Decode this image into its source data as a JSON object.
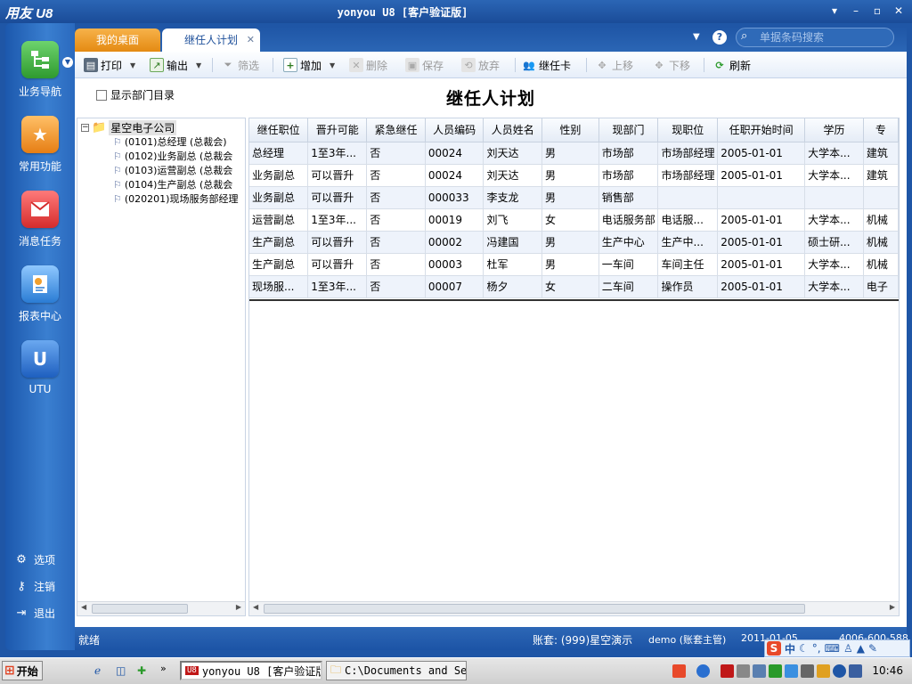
{
  "app": {
    "logo": "用友 U8",
    "title": "yonyou U8 [客户验证版]"
  },
  "window_controls": [
    "▾",
    "–",
    "▫",
    "✕"
  ],
  "nav": {
    "items": [
      {
        "label": "业务导航",
        "color": "#3aa83a"
      },
      {
        "label": "常用功能",
        "color": "#f0922a"
      },
      {
        "label": "消息任务",
        "color": "#e24a4a"
      },
      {
        "label": "报表中心",
        "color": "#3a8fe0"
      },
      {
        "label": "UTU",
        "color": "#2a6fd0"
      }
    ],
    "bottom": [
      {
        "label": "选项"
      },
      {
        "label": "注销"
      },
      {
        "label": "退出"
      }
    ]
  },
  "tabs": [
    {
      "label": "我的桌面"
    },
    {
      "label": "继任人计划"
    }
  ],
  "search": {
    "placeholder": "单据条码搜索"
  },
  "toolbar": {
    "print": "打印",
    "export": "输出",
    "filter": "筛选",
    "add": "增加",
    "delete": "删除",
    "save": "保存",
    "discard": "放弃",
    "successor_card": "继任卡",
    "move_up": "上移",
    "move_down": "下移",
    "refresh": "刷新"
  },
  "options": {
    "show_dept_dir": "显示部门目录"
  },
  "page_title": "继任人计划",
  "tree": {
    "root": "星空电子公司",
    "children": [
      "(0101)总经理 (总裁会)",
      "(0102)业务副总 (总裁会",
      "(0103)运营副总 (总裁会",
      "(0104)生产副总 (总裁会",
      "(020201)现场服务部经理"
    ]
  },
  "grid": {
    "columns": [
      "继任职位",
      "晋升可能",
      "紧急继任",
      "人员编码",
      "人员姓名",
      "性别",
      "现部门",
      "现职位",
      "任职开始时间",
      "学历",
      "专"
    ],
    "rows": [
      [
        "总经理",
        "1至3年...",
        "否",
        "00024",
        "刘天达",
        "男",
        "市场部",
        "市场部经理",
        "2005-01-01",
        "大学本...",
        "建筑"
      ],
      [
        "业务副总",
        "可以晋升",
        "否",
        "00024",
        "刘天达",
        "男",
        "市场部",
        "市场部经理",
        "2005-01-01",
        "大学本...",
        "建筑"
      ],
      [
        "业务副总",
        "可以晋升",
        "否",
        "000033",
        "李支龙",
        "男",
        "销售部",
        "",
        "",
        "",
        ""
      ],
      [
        "运营副总",
        "1至3年...",
        "否",
        "00019",
        "刘飞",
        "女",
        "电话服务部",
        "电话服...",
        "2005-01-01",
        "大学本...",
        "机械"
      ],
      [
        "生产副总",
        "可以晋升",
        "否",
        "00002",
        "冯建国",
        "男",
        "生产中心",
        "生产中...",
        "2005-01-01",
        "硕士研...",
        "机械"
      ],
      [
        "生产副总",
        "可以晋升",
        "否",
        "00003",
        "杜军",
        "男",
        "一车间",
        "车间主任",
        "2005-01-01",
        "大学本...",
        "机械"
      ],
      [
        "现场服...",
        "1至3年...",
        "否",
        "00007",
        "杨夕",
        "女",
        "二车间",
        "操作员",
        "2005-01-01",
        "大学本...",
        "电子"
      ]
    ]
  },
  "status": {
    "ready": "就绪",
    "account": "账套: (999)星空演示",
    "user": "demo (账套主管)",
    "date": "2011-01-05",
    "phone": "4006-600-588"
  },
  "taskbar": {
    "start": "开始",
    "tasks": [
      {
        "label": "yonyou U8 [客户验证版]"
      },
      {
        "label": "C:\\Documents and Se..."
      }
    ],
    "clock": "10:46"
  },
  "ime": {
    "mode": "中"
  }
}
